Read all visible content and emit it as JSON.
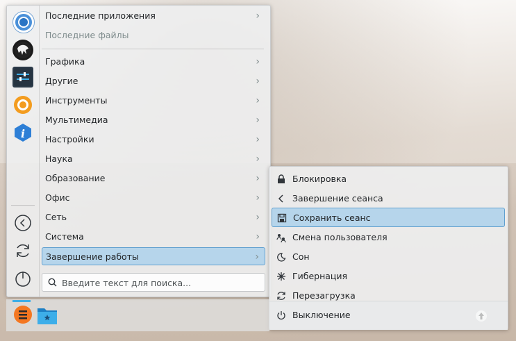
{
  "menu": {
    "categories": [
      {
        "label": "Последние приложения",
        "has_submenu": true
      },
      {
        "label": "Последние файлы",
        "has_submenu": false,
        "dimmed": true
      },
      {
        "label": "Графика",
        "has_submenu": true
      },
      {
        "label": "Другие",
        "has_submenu": true
      },
      {
        "label": "Инструменты",
        "has_submenu": true
      },
      {
        "label": "Мультимедиа",
        "has_submenu": true
      },
      {
        "label": "Настройки",
        "has_submenu": true
      },
      {
        "label": "Наука",
        "has_submenu": true
      },
      {
        "label": "Образование",
        "has_submenu": true
      },
      {
        "label": "Офис",
        "has_submenu": true
      },
      {
        "label": "Сеть",
        "has_submenu": true
      },
      {
        "label": "Система",
        "has_submenu": true
      },
      {
        "label": "Завершение работы",
        "has_submenu": true,
        "selected": true
      }
    ],
    "search": {
      "placeholder": "Введите текст для поиска..."
    },
    "favorites": [
      "chromium-icon",
      "inkscape-icon",
      "settings-sliders-icon",
      "software-center-icon",
      "info-center-icon"
    ],
    "system_buttons": [
      "back-icon",
      "refresh-icon",
      "power-icon"
    ]
  },
  "submenu": {
    "items": [
      {
        "label": "Блокировка",
        "icon": "lock-icon"
      },
      {
        "label": "Завершение сеанса",
        "icon": "logout-arrow-icon"
      },
      {
        "label": "Сохранить сеанс",
        "icon": "save-icon",
        "selected": true
      },
      {
        "label": "Смена пользователя",
        "icon": "switch-user-icon"
      },
      {
        "label": "Сон",
        "icon": "sleep-icon"
      },
      {
        "label": "Гибернация",
        "icon": "hibernate-icon"
      },
      {
        "label": "Перезагрузка",
        "icon": "reboot-icon"
      },
      {
        "label": "Выключение",
        "icon": "shutdown-icon"
      }
    ]
  },
  "colors": {
    "accent": "#3daee9",
    "selection": "#add1eb",
    "selection_border": "#5f9fcf"
  }
}
